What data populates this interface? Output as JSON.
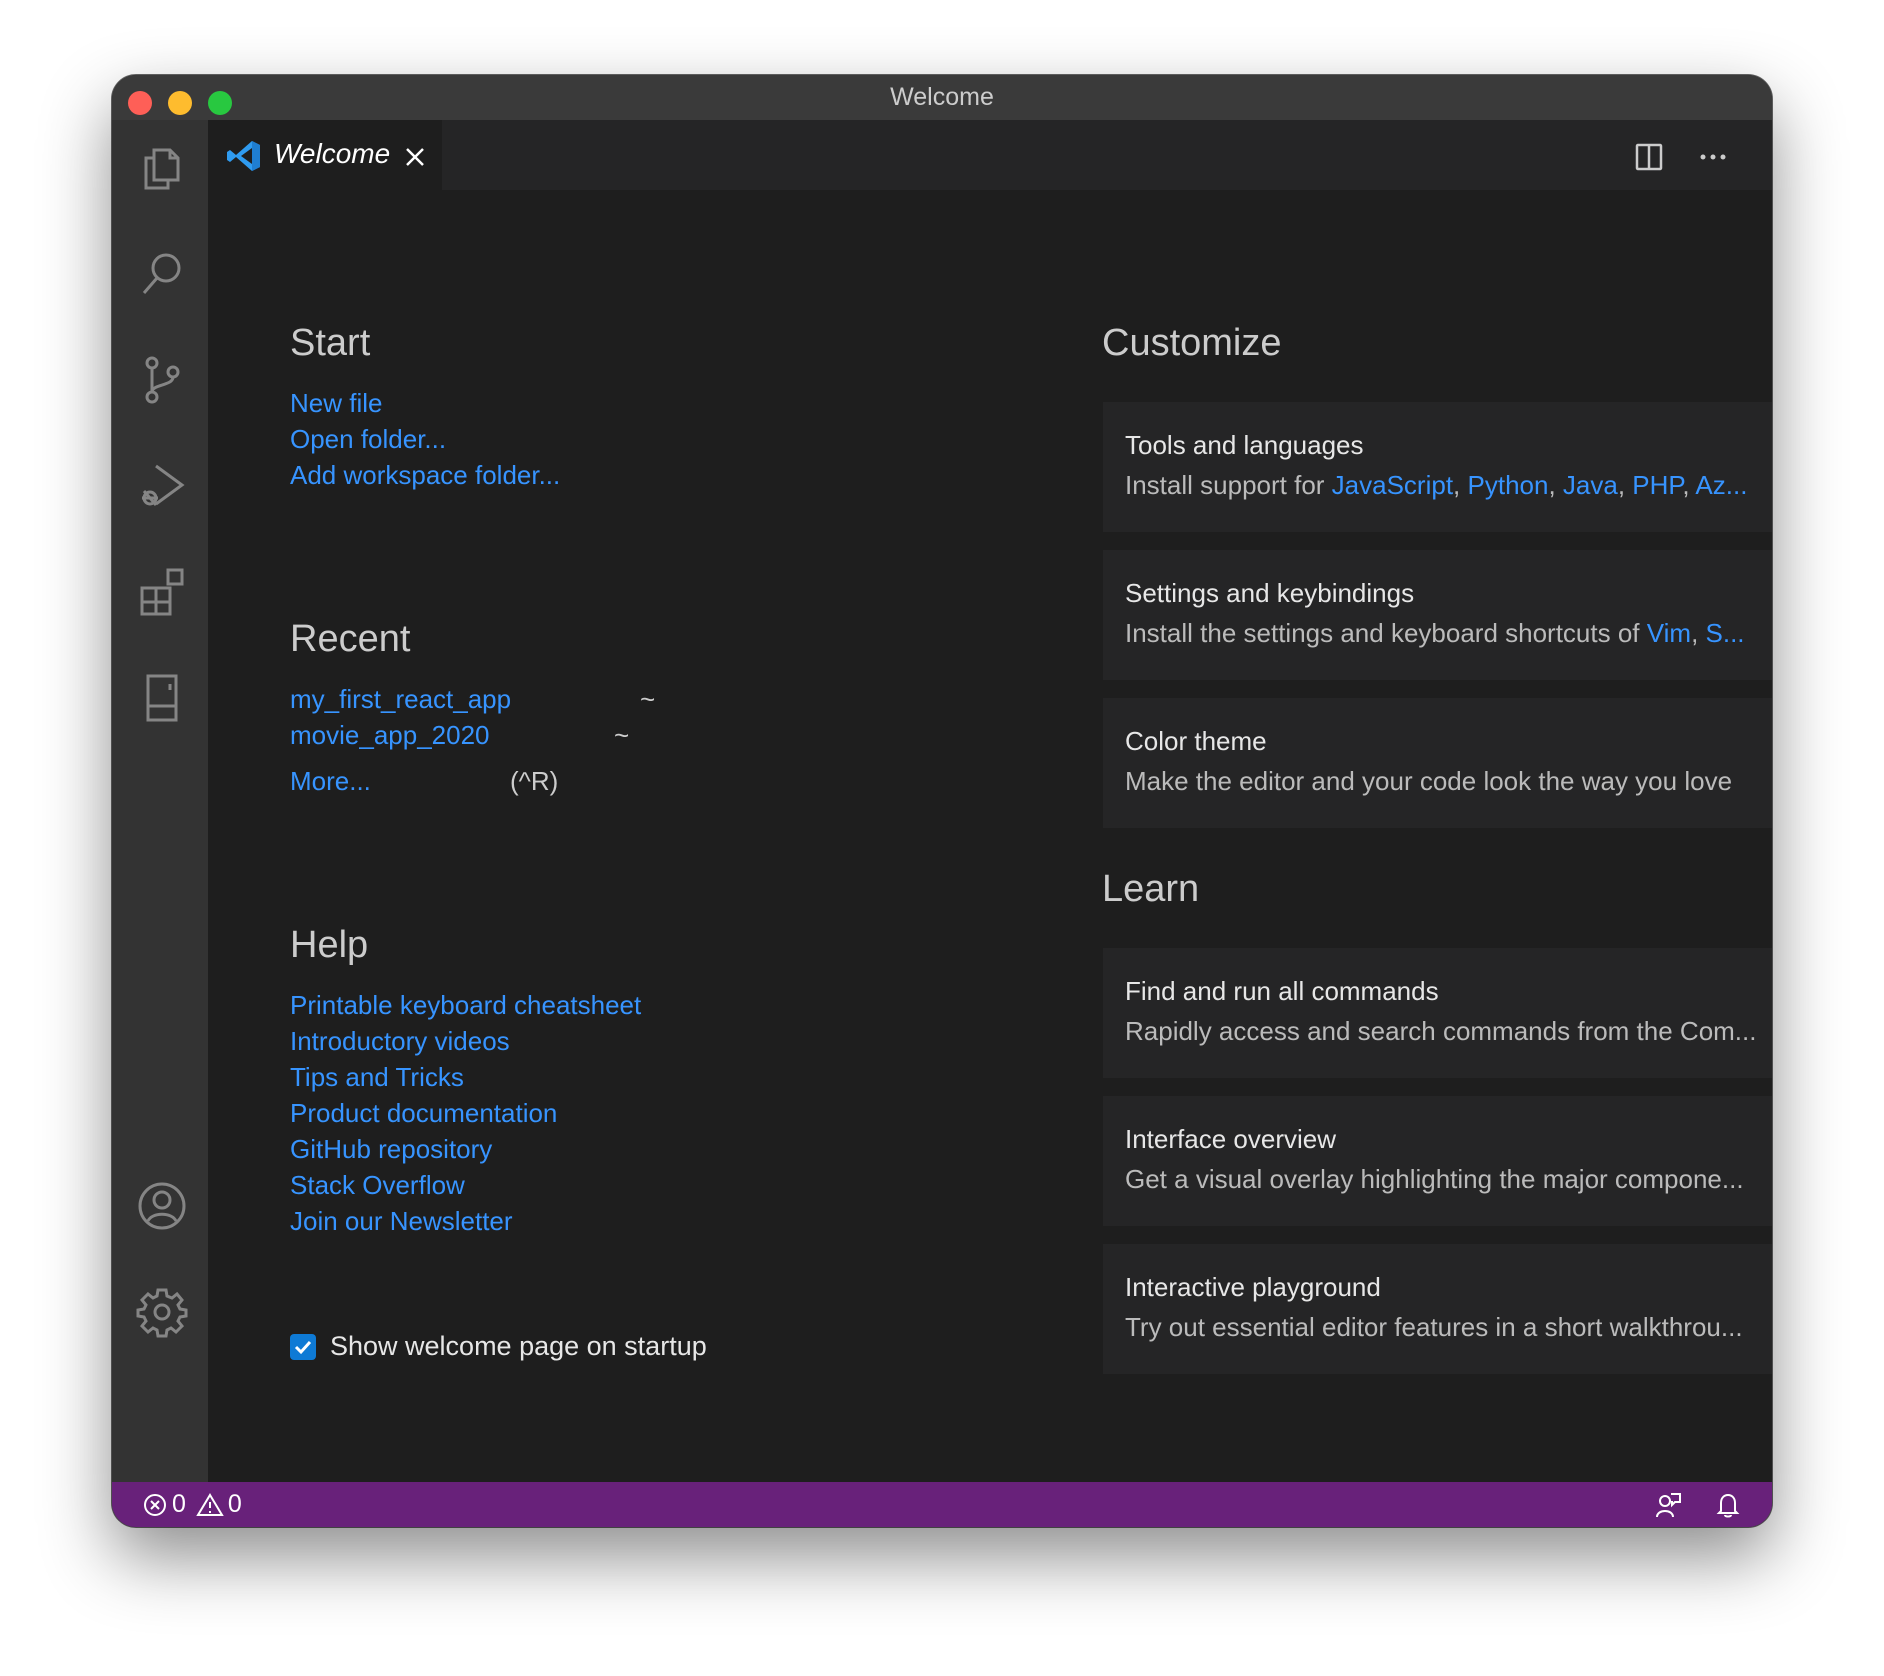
{
  "window": {
    "title": "Welcome"
  },
  "activity_bar": {
    "items": [
      "files-icon",
      "search-icon",
      "source-control-icon",
      "run-debug-icon",
      "extensions-icon",
      "remote-explorer-icon"
    ],
    "bottom_items": [
      "account-icon",
      "settings-gear-icon"
    ]
  },
  "tab": {
    "label": "Welcome"
  },
  "start": {
    "title": "Start",
    "links": [
      "New file",
      "Open folder...",
      "Add workspace folder..."
    ]
  },
  "recent": {
    "title": "Recent",
    "items": [
      {
        "name": "my_first_react_app",
        "path": "~"
      },
      {
        "name": "movie_app_2020",
        "path": "~"
      }
    ],
    "more_label": "More...",
    "more_shortcut": "(^R)"
  },
  "help": {
    "title": "Help",
    "links": [
      "Printable keyboard cheatsheet",
      "Introductory videos",
      "Tips and Tricks",
      "Product documentation",
      "GitHub repository",
      "Stack Overflow",
      "Join our Newsletter"
    ]
  },
  "startup_checkbox": {
    "label": "Show welcome page on startup",
    "checked": true
  },
  "customize": {
    "title": "Customize",
    "cards": [
      {
        "title": "Tools and languages",
        "desc_prefix": "Install support for ",
        "desc_links": [
          "JavaScript",
          "Python",
          "Java",
          "PHP",
          "Az..."
        ]
      },
      {
        "title": "Settings and keybindings",
        "desc_prefix": "Install the settings and keyboard shortcuts of ",
        "desc_links": [
          "Vim",
          "S..."
        ]
      },
      {
        "title": "Color theme",
        "desc": "Make the editor and your code look the way you love"
      }
    ]
  },
  "learn": {
    "title": "Learn",
    "cards": [
      {
        "title": "Find and run all commands",
        "desc": "Rapidly access and search commands from the Com..."
      },
      {
        "title": "Interface overview",
        "desc": "Get a visual overlay highlighting the major compone..."
      },
      {
        "title": "Interactive playground",
        "desc": "Try out essential editor features in a short walkthrou..."
      }
    ]
  },
  "status_bar": {
    "errors": "0",
    "warnings": "0",
    "color": "#68217a"
  },
  "colors": {
    "link": "#3794ff",
    "editor_bg": "#1e1e1e",
    "activity_bar_bg": "#333333"
  }
}
